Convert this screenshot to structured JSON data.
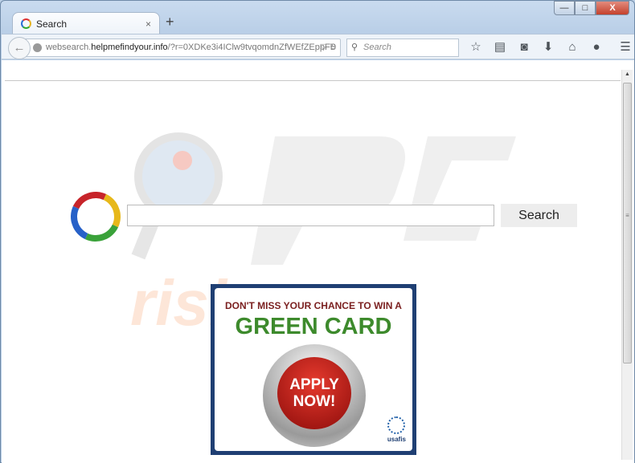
{
  "tab": {
    "title": "Search",
    "close": "×",
    "new_tab": "+"
  },
  "window": {
    "minimize": "—",
    "maximize": "□",
    "close": "X"
  },
  "nav": {
    "back": "←",
    "url_prefix": "websearch.",
    "url_domain": "helpmefindyour.info",
    "url_path": "/?r=0XDKe3i4IClw9tvqomdnZfWEfZEppFB",
    "dropdown": "▽",
    "reload": "↻",
    "search_placeholder": "Search"
  },
  "toolbar_icons": [
    "star-icon",
    "reading-list-icon",
    "pocket-icon",
    "download-icon",
    "home-icon",
    "chat-icon",
    "menu-icon"
  ],
  "page": {
    "search_button": "Search",
    "search_value": ""
  },
  "watermark": "PC risk.com",
  "ad": {
    "line1": "DON'T MISS YOUR CHANCE TO WIN A",
    "line2": "GREEN CARD",
    "button_line1": "APPLY",
    "button_line2": "NOW!",
    "brand": "usafis"
  },
  "colors": {
    "ad_border": "#1f3f73",
    "green": "#3d8a2c",
    "red": "#c7242a"
  }
}
